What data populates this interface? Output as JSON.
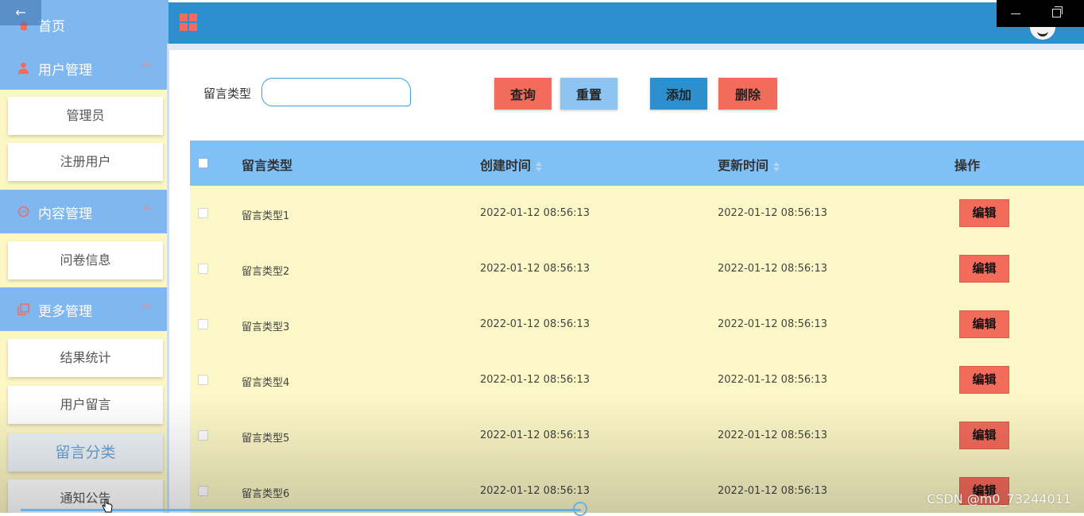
{
  "sidebar": {
    "home_label": "首页",
    "groups": [
      {
        "label": "用户管理",
        "items": [
          "管理员",
          "注册用户"
        ]
      },
      {
        "label": "内容管理",
        "items": [
          "问卷信息"
        ]
      },
      {
        "label": "更多管理",
        "items": [
          "结果统计",
          "用户留言",
          "留言分类",
          "通知公告"
        ]
      }
    ],
    "active_item": "留言分类"
  },
  "search": {
    "label": "留言类型",
    "value": "",
    "placeholder": ""
  },
  "buttons": {
    "query": "查询",
    "reset": "重置",
    "add": "添加",
    "delete": "删除"
  },
  "table": {
    "columns": [
      "留言类型",
      "创建时间",
      "更新时间",
      "操作"
    ],
    "rows": [
      {
        "name": "留言类型1",
        "created": "2022-01-12 08:56:13",
        "updated": "2022-01-12 08:56:13",
        "action": "编辑"
      },
      {
        "name": "留言类型2",
        "created": "2022-01-12 08:56:13",
        "updated": "2022-01-12 08:56:13",
        "action": "编辑"
      },
      {
        "name": "留言类型3",
        "created": "2022-01-12 08:56:13",
        "updated": "2022-01-12 08:56:13",
        "action": "编辑"
      },
      {
        "name": "留言类型4",
        "created": "2022-01-12 08:56:13",
        "updated": "2022-01-12 08:56:13",
        "action": "编辑"
      },
      {
        "name": "留言类型5",
        "created": "2022-01-12 08:56:13",
        "updated": "2022-01-12 08:56:13",
        "action": "编辑"
      },
      {
        "name": "留言类型6",
        "created": "2022-01-12 08:56:13",
        "updated": "2022-01-12 08:56:13",
        "action": "编辑"
      }
    ]
  },
  "watermark": "CSDN @m0_73244011",
  "icons": {
    "home": "home-icon",
    "user": "user-icon",
    "content": "chat-icon",
    "more": "copy-icon",
    "menu": "grid-menu-icon",
    "back": "back-arrow-icon",
    "avatar": "avatar"
  },
  "colors": {
    "topbar": "#2e8fce",
    "sidebar_header": "#7fb8f0",
    "table_header": "#7fc0f7",
    "row_bg": "#fbf7c6",
    "danger": "#f26b5b",
    "secondary": "#8ec4f2",
    "primary": "#2e8fce"
  }
}
